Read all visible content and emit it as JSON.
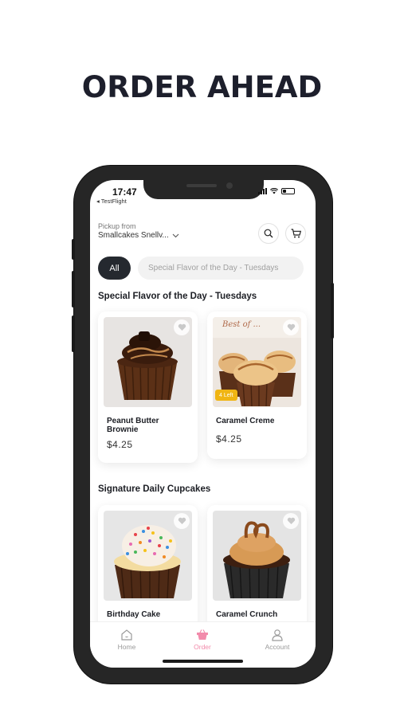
{
  "promo": {
    "headline": "ORDER AHEAD"
  },
  "status_bar": {
    "time": "17:47",
    "back_label": "◂ TestFlight"
  },
  "header": {
    "pickup_label": "Pickup from",
    "store_name": "Smallcakes Snellv...",
    "search_icon": "search-icon",
    "cart_icon": "cart-icon"
  },
  "filters": [
    {
      "label": "All",
      "selected": true
    },
    {
      "label": "Special Flavor of the Day - Tuesdays",
      "selected": false
    }
  ],
  "sections": [
    {
      "title": "Special Flavor of the Day - Tuesdays",
      "products": [
        {
          "name": "Peanut Butter Brownie",
          "price": "$4.25",
          "badge": ""
        },
        {
          "name": "Caramel Creme",
          "price": "$4.25",
          "badge": "4 Left"
        }
      ]
    },
    {
      "title": "Signature Daily Cupcakes",
      "products": [
        {
          "name": "Birthday Cake",
          "price": "",
          "badge": ""
        },
        {
          "name": "Caramel Crunch",
          "price": "",
          "badge": ""
        }
      ]
    }
  ],
  "image_text": {
    "banner": "Best of ..."
  },
  "tabbar": {
    "items": [
      {
        "label": "Home",
        "icon": "home-icon",
        "active": false
      },
      {
        "label": "Order",
        "icon": "order-icon",
        "active": true
      },
      {
        "label": "Account",
        "icon": "account-icon",
        "active": false
      }
    ]
  },
  "colors": {
    "accent_pink": "#f28bab",
    "chip_dark": "#25292f",
    "badge_yellow": "#f0b513",
    "phone_frame": "#262626"
  }
}
